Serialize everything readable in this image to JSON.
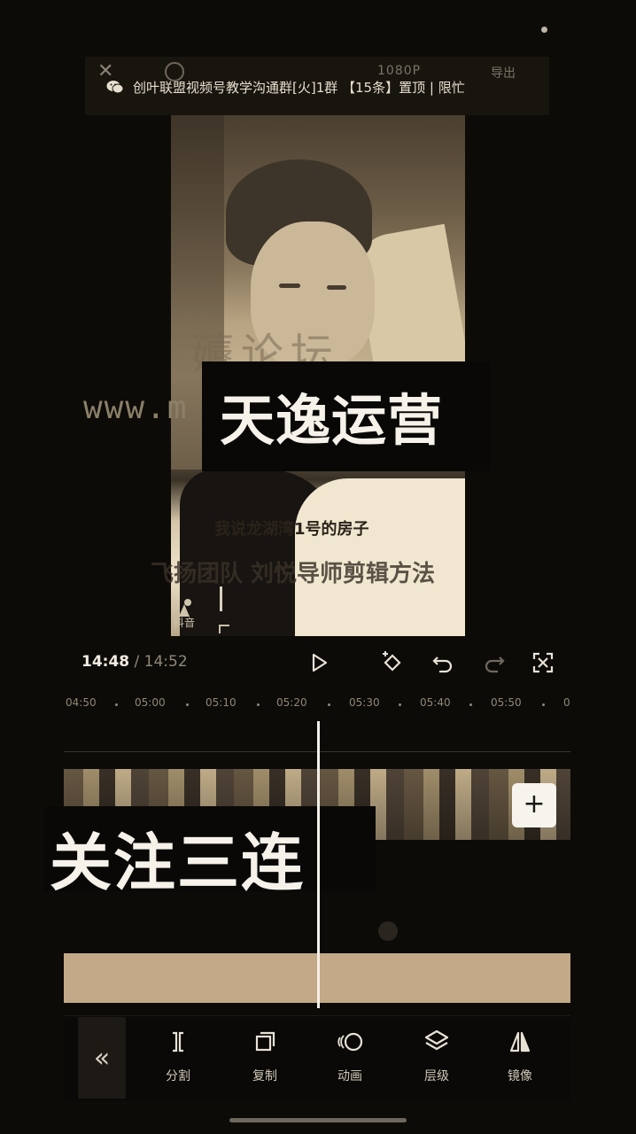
{
  "notification": {
    "text": "创叶联盟视频号教学沟通群[火]1群 【15条】置顶 | 限忙",
    "resolution": "1080P",
    "export_label": "导出"
  },
  "preview": {
    "watermark_faded": "薅论坛",
    "watermark_url": "www.m",
    "title": "天逸运营",
    "subtitle": "我说龙湖湾1号的房子",
    "caption": "飞扬团队 刘悦导师剪辑方法",
    "logo_text": "抖音"
  },
  "playback": {
    "current_time": "14:48",
    "separator": " / ",
    "total_time": "14:52",
    "controls": [
      "play-icon",
      "keyframe-icon",
      "undo-icon",
      "redo-icon",
      "fullscreen-icon"
    ]
  },
  "ruler": {
    "ticks": [
      "04:50",
      "05:00",
      "05:10",
      "05:20",
      "05:30",
      "05:40",
      "05:50",
      "0"
    ]
  },
  "timeline": {
    "overlay_text": "关注三连",
    "add_label": "+"
  },
  "toolbar": {
    "back_label": "«",
    "items": [
      {
        "label": "分割",
        "icon": "split-icon"
      },
      {
        "label": "复制",
        "icon": "copy-icon"
      },
      {
        "label": "动画",
        "icon": "animation-icon"
      },
      {
        "label": "层级",
        "icon": "layers-icon"
      },
      {
        "label": "镜像",
        "icon": "mirror-icon"
      }
    ]
  },
  "colors": {
    "background": "#0d0b08",
    "audio_track": "#c3a987",
    "text_primary": "#f6f2ea",
    "text_muted": "#8f8878"
  }
}
